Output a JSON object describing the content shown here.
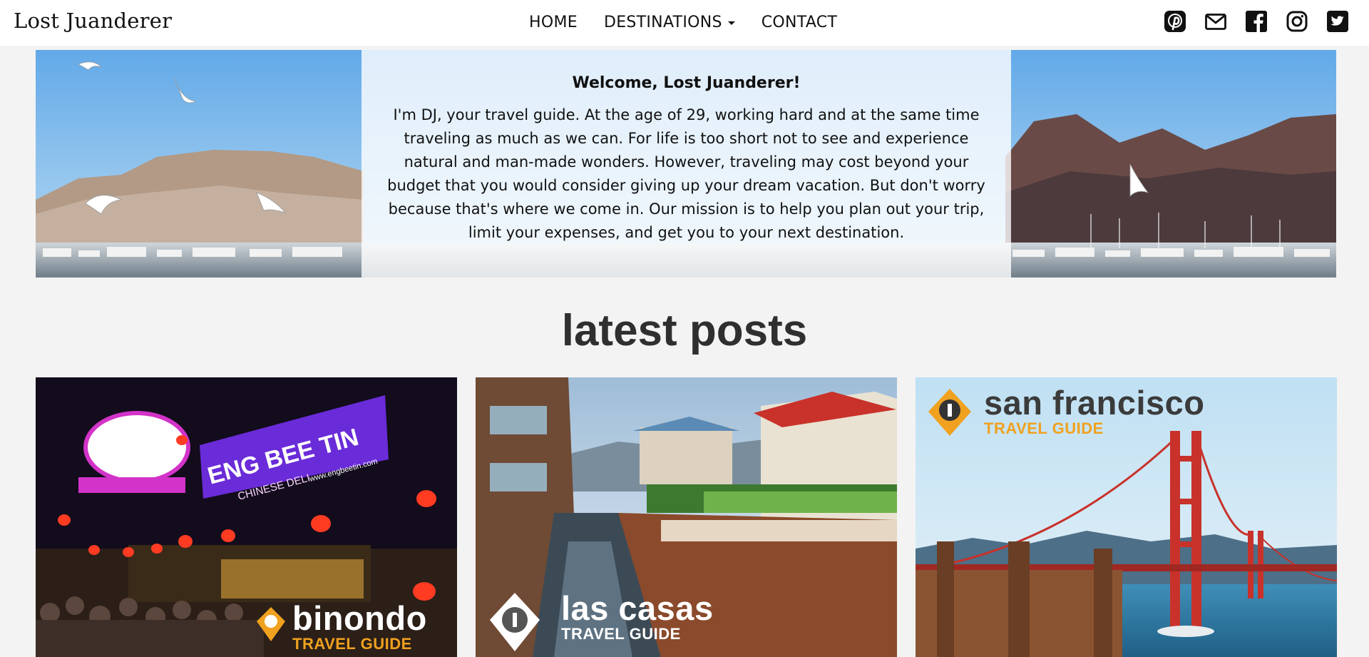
{
  "site": {
    "brand": "Lost Juanderer"
  },
  "nav": {
    "home": "HOME",
    "destinations": "DESTINATIONS",
    "contact": "CONTACT"
  },
  "social": [
    "pinterest-icon",
    "mail-icon",
    "facebook-icon",
    "instagram-icon",
    "twitter-icon"
  ],
  "hero": {
    "title": "Welcome, Lost Juanderer!",
    "body": "I'm DJ, your travel guide. At the age of 29, working hard and at the same time traveling as much as we can. For life is too short not to see and experience natural and man-made wonders. However, traveling may cost beyond your budget that you would consider giving up your dream vacation. But don't worry because that's where we come in. Our mission is to help you plan out your trip, limit your expenses, and get you to your next destination."
  },
  "latest": {
    "title": "latest posts",
    "posts": [
      {
        "name": "binondo",
        "subtitle": "TRAVEL GUIDE",
        "sign1": "ENG BEE TIN",
        "sign2": "CHINESE DELI",
        "sign3": "www.engbeetin.com"
      },
      {
        "name": "las casas",
        "subtitle": "TRAVEL GUIDE"
      },
      {
        "name": "san francisco",
        "subtitle": "TRAVEL GUIDE"
      }
    ]
  },
  "colors": {
    "accent_orange": "#f0a11f",
    "bridge_red": "#c8322a",
    "sign_purple": "#6a2bd8"
  }
}
